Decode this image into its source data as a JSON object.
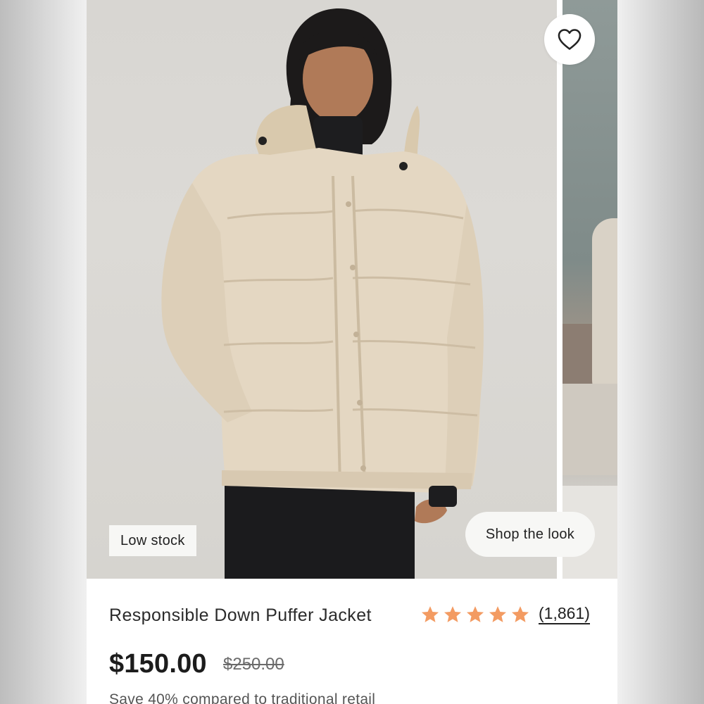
{
  "product": {
    "title": "Responsible Down Puffer Jacket",
    "rating": 5,
    "rating_max": 5,
    "review_count": "(1,861)",
    "price": "$150.00",
    "original_price": "$250.00",
    "savings_text": "Save 40% compared to traditional retail"
  },
  "gallery": {
    "badge": "Low stock",
    "shop_the_look": "Shop the look",
    "wishlist_icon": "heart-outline-icon"
  },
  "colors": {
    "star": "#F39B62",
    "text": "#2B2B2B",
    "badge_bg": "#F7F7F5"
  }
}
